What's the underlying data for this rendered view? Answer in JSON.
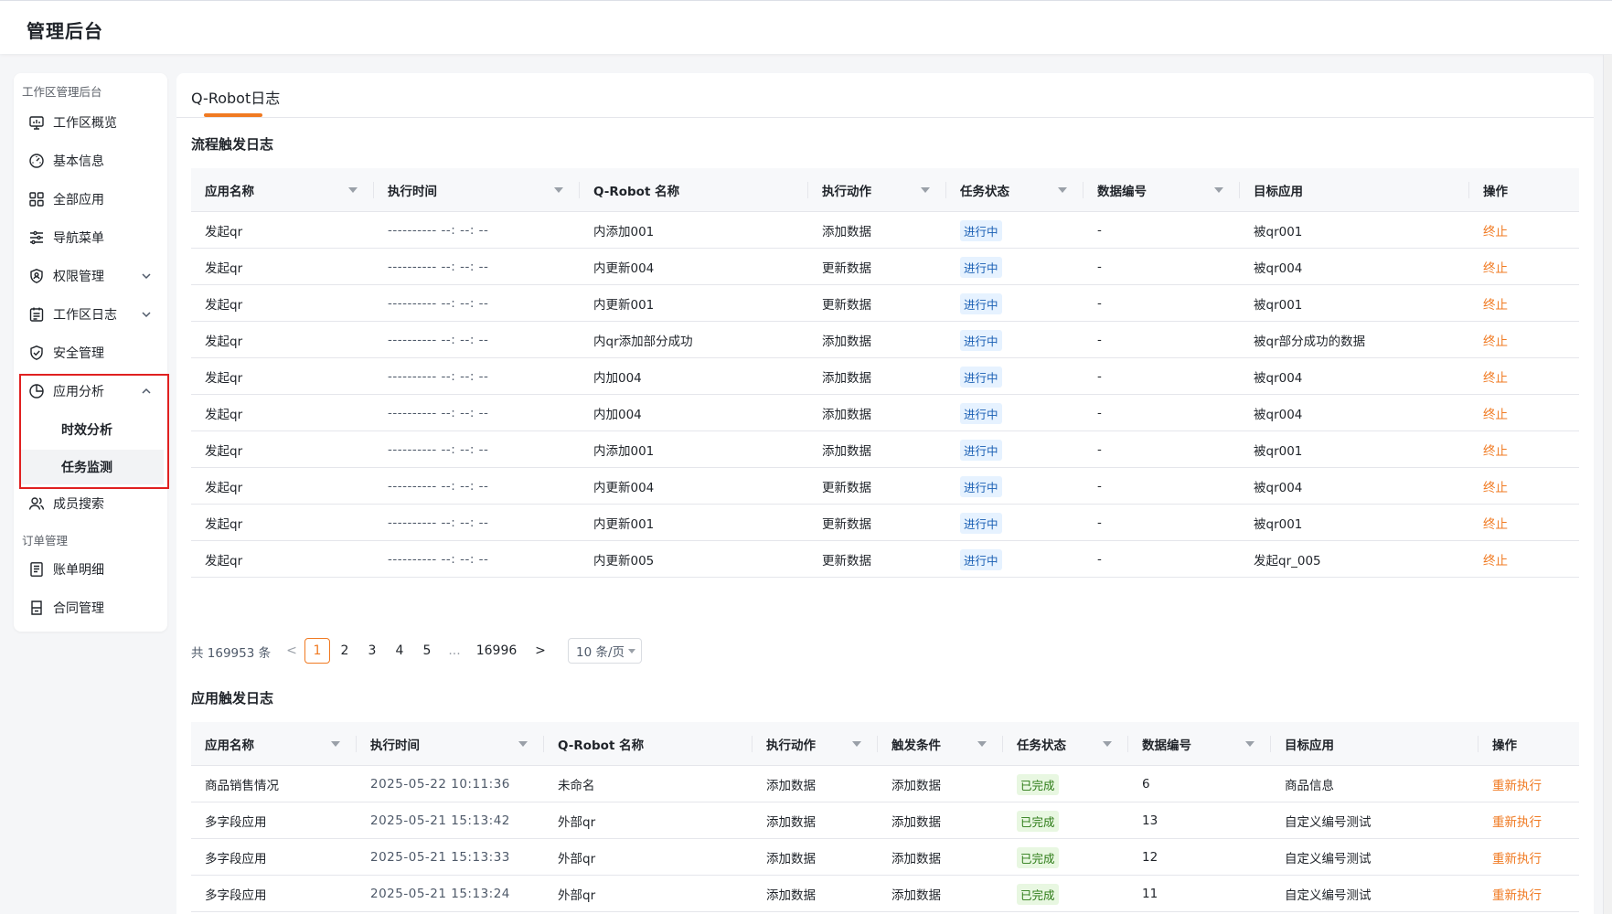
{
  "header": {
    "title": "管理后台"
  },
  "sidebar": {
    "group1": "工作区管理后台",
    "group2": "订单管理",
    "items": [
      {
        "label": "工作区概览",
        "icon": "monitor-icon"
      },
      {
        "label": "基本信息",
        "icon": "dashboard-gauge-icon"
      },
      {
        "label": "全部应用",
        "icon": "grid-apps-icon"
      },
      {
        "label": "导航菜单",
        "icon": "sliders-icon"
      },
      {
        "label": "权限管理",
        "icon": "shield-user-icon"
      },
      {
        "label": "工作区日志",
        "icon": "calendar-log-icon"
      },
      {
        "label": "安全管理",
        "icon": "shield-check-icon"
      },
      {
        "label": "应用分析",
        "icon": "pie-chart-icon"
      },
      {
        "label": "成员搜索",
        "icon": "users-icon"
      },
      {
        "label": "账单明细",
        "icon": "bill-icon"
      },
      {
        "label": "合同管理",
        "icon": "contract-icon"
      }
    ],
    "sub_items": [
      {
        "label": "时效分析"
      },
      {
        "label": "任务监测",
        "active": true
      }
    ]
  },
  "main": {
    "tab": "Q-Robot日志",
    "flow_section": {
      "title": "流程触发日志",
      "columns": [
        "应用名称",
        "执行时间",
        "Q-Robot 名称",
        "执行动作",
        "任务状态",
        "数据编号",
        "目标应用",
        "操作"
      ],
      "rows": [
        {
          "app": "发起qr",
          "time": "---------- --: --: --",
          "robot": "内添加001",
          "action": "添加数据",
          "status": "进行中",
          "data_no": "-",
          "target": "被qr001",
          "op": "终止"
        },
        {
          "app": "发起qr",
          "time": "---------- --: --: --",
          "robot": "内更新004",
          "action": "更新数据",
          "status": "进行中",
          "data_no": "-",
          "target": "被qr004",
          "op": "终止"
        },
        {
          "app": "发起qr",
          "time": "---------- --: --: --",
          "robot": "内更新001",
          "action": "更新数据",
          "status": "进行中",
          "data_no": "-",
          "target": "被qr001",
          "op": "终止"
        },
        {
          "app": "发起qr",
          "time": "---------- --: --: --",
          "robot": "内qr添加部分成功",
          "action": "添加数据",
          "status": "进行中",
          "data_no": "-",
          "target": "被qr部分成功的数据",
          "op": "终止"
        },
        {
          "app": "发起qr",
          "time": "---------- --: --: --",
          "robot": "内加004",
          "action": "添加数据",
          "status": "进行中",
          "data_no": "-",
          "target": "被qr004",
          "op": "终止"
        },
        {
          "app": "发起qr",
          "time": "---------- --: --: --",
          "robot": "内加004",
          "action": "添加数据",
          "status": "进行中",
          "data_no": "-",
          "target": "被qr004",
          "op": "终止"
        },
        {
          "app": "发起qr",
          "time": "---------- --: --: --",
          "robot": "内添加001",
          "action": "添加数据",
          "status": "进行中",
          "data_no": "-",
          "target": "被qr001",
          "op": "终止"
        },
        {
          "app": "发起qr",
          "time": "---------- --: --: --",
          "robot": "内更新004",
          "action": "更新数据",
          "status": "进行中",
          "data_no": "-",
          "target": "被qr004",
          "op": "终止"
        },
        {
          "app": "发起qr",
          "time": "---------- --: --: --",
          "robot": "内更新001",
          "action": "更新数据",
          "status": "进行中",
          "data_no": "-",
          "target": "被qr001",
          "op": "终止"
        },
        {
          "app": "发起qr",
          "time": "---------- --: --: --",
          "robot": "内更新005",
          "action": "更新数据",
          "status": "进行中",
          "data_no": "-",
          "target": "发起qr_005",
          "op": "终止"
        }
      ],
      "pagination": {
        "total": "共 169953 条",
        "prev": "<",
        "pages": [
          "1",
          "2",
          "3",
          "4",
          "5"
        ],
        "active": "1",
        "ellipsis": "...",
        "last": "16996",
        "next": ">",
        "page_size": "10 条/页"
      }
    },
    "app_section": {
      "title": "应用触发日志",
      "columns": [
        "应用名称",
        "执行时间",
        "Q-Robot 名称",
        "执行动作",
        "触发条件",
        "任务状态",
        "数据编号",
        "目标应用",
        "操作"
      ],
      "rows": [
        {
          "app": "商品销售情况",
          "time": "2025-05-22 10:11:36",
          "robot": "未命名",
          "action": "添加数据",
          "trigger": "添加数据",
          "status": "已完成",
          "data_no": "6",
          "target": "商品信息",
          "op": "重新执行"
        },
        {
          "app": "多字段应用",
          "time": "2025-05-21 15:13:42",
          "robot": "外部qr",
          "action": "添加数据",
          "trigger": "添加数据",
          "status": "已完成",
          "data_no": "13",
          "target": "自定义编号测试",
          "op": "重新执行"
        },
        {
          "app": "多字段应用",
          "time": "2025-05-21 15:13:33",
          "robot": "外部qr",
          "action": "添加数据",
          "trigger": "添加数据",
          "status": "已完成",
          "data_no": "12",
          "target": "自定义编号测试",
          "op": "重新执行"
        },
        {
          "app": "多字段应用",
          "time": "2025-05-21 15:13:24",
          "robot": "外部qr",
          "action": "添加数据",
          "trigger": "添加数据",
          "status": "已完成",
          "data_no": "11",
          "target": "自定义编号测试",
          "op": "重新执行"
        }
      ]
    }
  },
  "colors": {
    "accent": "#f07a22",
    "highlight_box": "#e02020",
    "running_bg": "#e6f2ff",
    "done_bg": "#e8f7e1"
  }
}
